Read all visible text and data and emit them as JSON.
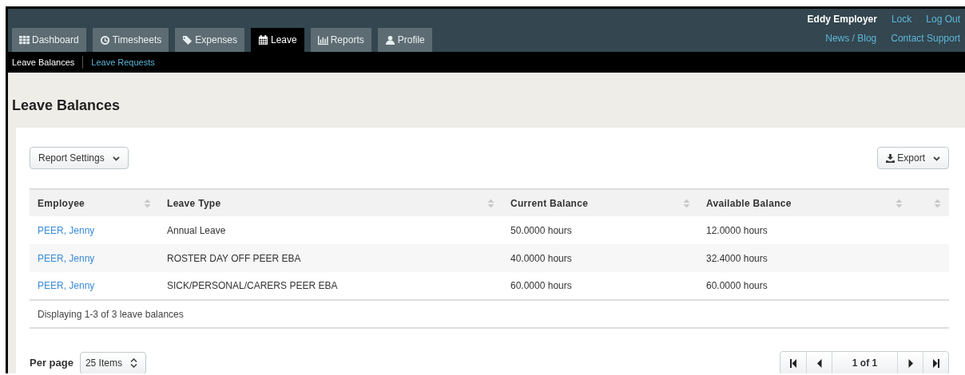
{
  "nav_tabs": [
    {
      "label": "Dashboard",
      "selected": false
    },
    {
      "label": "Timesheets",
      "selected": false
    },
    {
      "label": "Expenses",
      "selected": false
    },
    {
      "label": "Leave",
      "selected": true
    },
    {
      "label": "Reports",
      "selected": false
    },
    {
      "label": "Profile",
      "selected": false
    }
  ],
  "user_menu": {
    "user_name": "Eddy Employer",
    "links": [
      "Lock",
      "Log Out"
    ],
    "links_2": [
      "News / Blog",
      "Contact Support"
    ]
  },
  "sub_nav": [
    {
      "label": "Leave Balances",
      "selected": true
    },
    {
      "label": "Leave Requests",
      "selected": false
    }
  ],
  "page_title": "Leave Balances",
  "report_settings_button": "Report Settings",
  "export_button": "Export",
  "table": {
    "columns": [
      "Employee",
      "Leave Type",
      "Current Balance",
      "Available Balance"
    ],
    "rows": [
      [
        "PEER, Jenny",
        "Annual Leave",
        "50.0000 hours",
        "12.0000 hours"
      ],
      [
        "PEER, Jenny",
        "ROSTER DAY OFF PEER EBA",
        "40.0000 hours",
        "32.4000 hours"
      ],
      [
        "PEER, Jenny",
        "SICK/PERSONAL/CARERS PEER EBA",
        "60.0000 hours",
        "60.0000 hours"
      ]
    ],
    "footer": "Displaying 1-3 of 3 leave balances"
  },
  "per_page": {
    "label": "Per page",
    "value": "25 Items"
  },
  "pagination": {
    "page": "1 of 1"
  }
}
